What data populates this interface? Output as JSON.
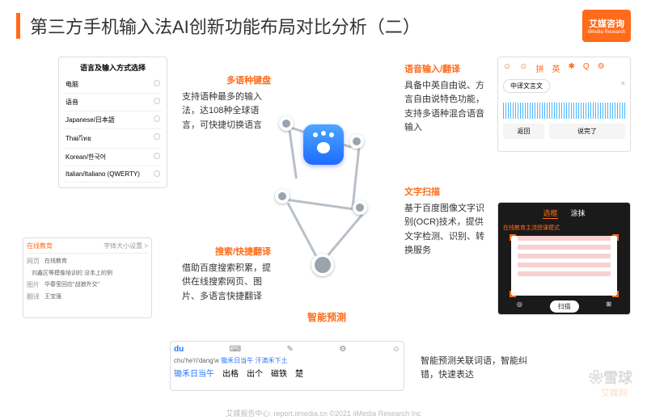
{
  "header": {
    "title": "第三方手机输入法AI创新功能布局对比分析（二）",
    "logo_zh": "艾媒咨询",
    "logo_en": "iiMedia Research"
  },
  "lang_panel": {
    "title": "语言及输入方式选择",
    "items": [
      "电脑",
      "语音",
      "Japanese/日本語",
      "Thai/ไทย",
      "Korean/한국어",
      "Italian/Italiano (QWERTY)"
    ]
  },
  "voice_panel": {
    "icons": [
      "☺",
      "☺",
      "拼",
      "英",
      "✱",
      "Q",
      "⚙"
    ],
    "tag": "中译文言文",
    "btn_back": "返回",
    "btn_done": "说完了"
  },
  "search_panel": {
    "tab_left": "在线教育",
    "tab_right": "字体大小设置 >",
    "side": [
      "网页",
      "图片",
      "翻译"
    ],
    "rows": [
      "在线教育",
      "刘鑫区等模像培训的 没本上的例",
      "华春莹回应\"战狼外交\"",
      "王宝强"
    ]
  },
  "ocr_panel": {
    "tab1": "选框",
    "tab2": "涂抹",
    "caption": "在线教育主流授课模式",
    "btn_cam": "◎",
    "btn_scan": "扫描",
    "btn_more": "⊞"
  },
  "ime_panel": {
    "icons": [
      "du",
      "⌨",
      "✎",
      "⚙",
      "☺"
    ],
    "pinyin": "chu'he'ri'dang'w",
    "hint": "锄禾日当午 汗滴禾下土",
    "cands": [
      "锄禾日当午",
      "出格",
      "出个",
      "磁铁",
      "楚"
    ]
  },
  "blocks": {
    "b1": {
      "hd": "多语种键盘",
      "body": "支持语种最多的输入法，达108种全球语言，可快捷切换语言"
    },
    "b2": {
      "hd": "语音输入/翻译",
      "body": "具备中英自由说、方言自由说特色功能，支持多语种混合语音输入"
    },
    "b3": {
      "hd": "文字扫描",
      "body": "基于百度图像文字识别(OCR)技术，提供文字检测、识别、转换服务"
    },
    "b4": {
      "hd": "搜索/快捷翻译",
      "body": "借助百度搜索积累，提供在线搜索网页、图片、多语言快捷翻译"
    },
    "b5": {
      "body": "智能预测关联词语，智能纠错，快速表达"
    },
    "pred": "智能预测"
  },
  "footer": "艾媒报告中心: report.iimedia.cn   ©2021 iiMedia Research Inc",
  "watermark1": "❀雪球",
  "watermark2": "艾媒网"
}
